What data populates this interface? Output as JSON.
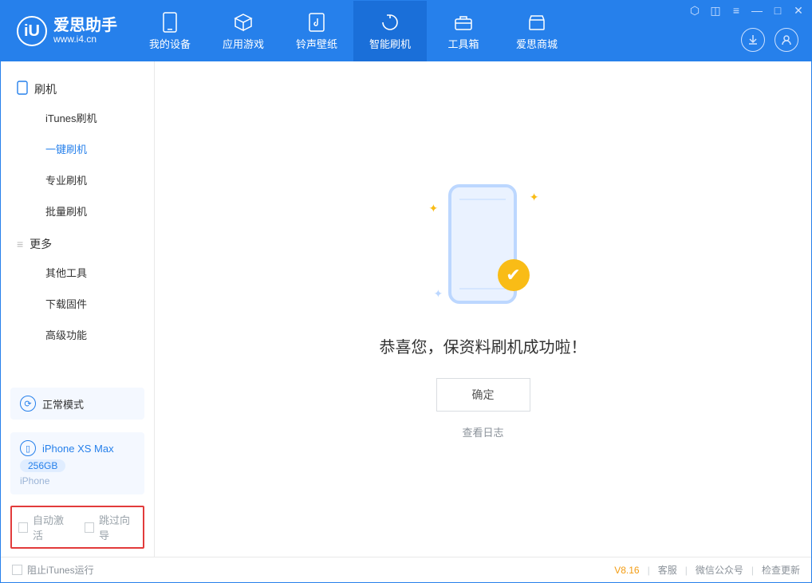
{
  "app": {
    "title": "爱思助手",
    "subtitle": "www.i4.cn"
  },
  "nav": [
    {
      "label": "我的设备"
    },
    {
      "label": "应用游戏"
    },
    {
      "label": "铃声壁纸"
    },
    {
      "label": "智能刷机"
    },
    {
      "label": "工具箱"
    },
    {
      "label": "爱思商城"
    }
  ],
  "sidebar": {
    "group1": "刷机",
    "items1": [
      {
        "label": "iTunes刷机"
      },
      {
        "label": "一键刷机"
      },
      {
        "label": "专业刷机"
      },
      {
        "label": "批量刷机"
      }
    ],
    "group2": "更多",
    "items2": [
      {
        "label": "其他工具"
      },
      {
        "label": "下载固件"
      },
      {
        "label": "高级功能"
      }
    ],
    "mode": "正常模式",
    "device": {
      "name": "iPhone XS Max",
      "capacity": "256GB",
      "type": "iPhone"
    },
    "opts": {
      "auto_activate": "自动激活",
      "skip_guide": "跳过向导"
    }
  },
  "main": {
    "message": "恭喜您，保资料刷机成功啦！",
    "ok": "确定",
    "viewlog": "查看日志"
  },
  "status": {
    "stop_itunes": "阻止iTunes运行",
    "version": "V8.16",
    "cs": "客服",
    "wechat": "微信公众号",
    "update": "检查更新"
  }
}
